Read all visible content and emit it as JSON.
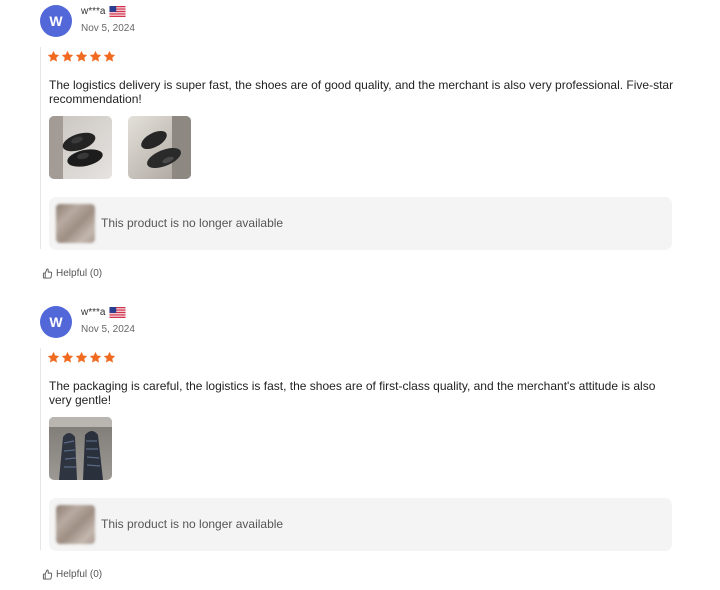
{
  "reviews": [
    {
      "avatar_letter": "W",
      "username": "w***a",
      "country_flag": "us-flag",
      "date": "Nov 5, 2024",
      "rating": 5,
      "star_color": "#f06a20",
      "text": "The logistics delivery is super fast, the shoes are of good quality, and the merchant is also very professional. Five-star recommendation!",
      "photos": [
        "black-sneakers-photo",
        "black-sneakers-photo"
      ],
      "product_status": "This product is no longer available",
      "helpful_label": "Helpful (0)"
    },
    {
      "avatar_letter": "W",
      "username": "w***a",
      "country_flag": "us-flag",
      "date": "Nov 5, 2024",
      "rating": 5,
      "star_color": "#f06a20",
      "text": "The packaging is careful, the logistics is fast, the shoes are of first-class quality, and the merchant's attitude is also very gentle!",
      "photos": [
        "worn-sneakers-photo"
      ],
      "product_status": "This product is no longer available",
      "helpful_label": "Helpful (0)"
    }
  ],
  "colors": {
    "avatar": "#5267d8",
    "star": "#f06a20",
    "product_box": "#f4f4f4"
  }
}
